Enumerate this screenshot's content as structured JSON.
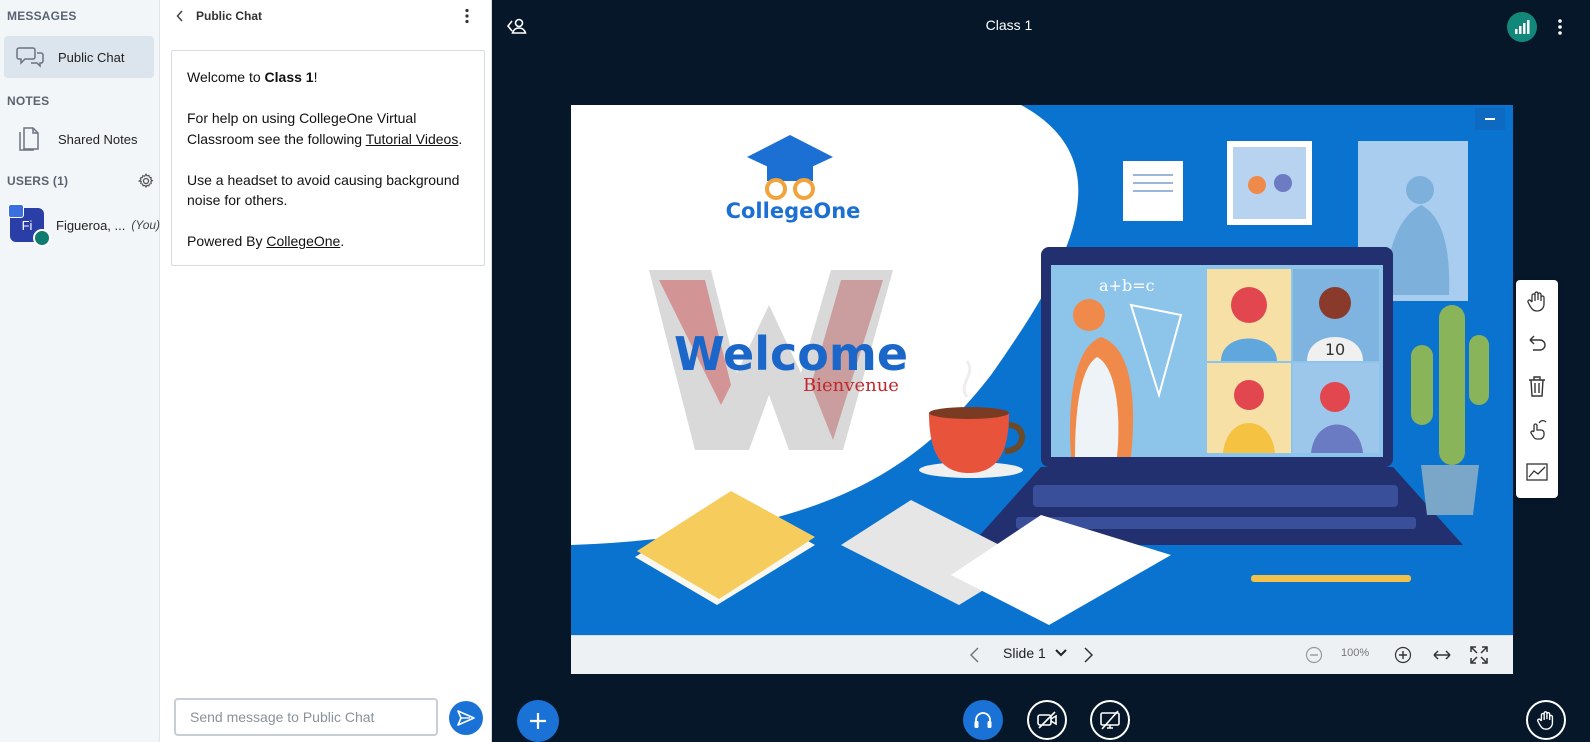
{
  "sidebar": {
    "messages_title": "MESSAGES",
    "public_chat_label": "Public Chat",
    "notes_title": "NOTES",
    "shared_notes_label": "Shared Notes",
    "users_title": "USERS (1)",
    "user": {
      "initials": "Fi",
      "name": "Figueroa, ...",
      "you_label": "(You)"
    }
  },
  "chat": {
    "title": "Public Chat",
    "welcome": {
      "line1_prefix": "Welcome to ",
      "line1_bold": "Class 1",
      "line1_suffix": "!",
      "help_prefix": "For help on using CollegeOne Virtual Classroom see the following ",
      "help_link": "Tutorial Videos",
      "help_suffix": ".",
      "headset_tip": "Use a headset to avoid causing background noise for others.",
      "powered_prefix": "Powered By ",
      "powered_link": "CollegeOne",
      "powered_suffix": "."
    },
    "input_placeholder": "Send message to Public Chat"
  },
  "main": {
    "title": "Class 1",
    "slide": {
      "logo_text": "CollegeOne",
      "welcome_text": "Welcome",
      "bienvenue_text": "Bienvenue",
      "math_text": "a+b=c",
      "shirt_number": "10"
    },
    "controls": {
      "slide_label": "Slide 1",
      "zoom_value": "100%"
    }
  },
  "colors": {
    "brand_blue": "#1b72d6",
    "connection_green": "#12887b",
    "background": "#06172a",
    "slide_blue": "#0a73cf"
  }
}
